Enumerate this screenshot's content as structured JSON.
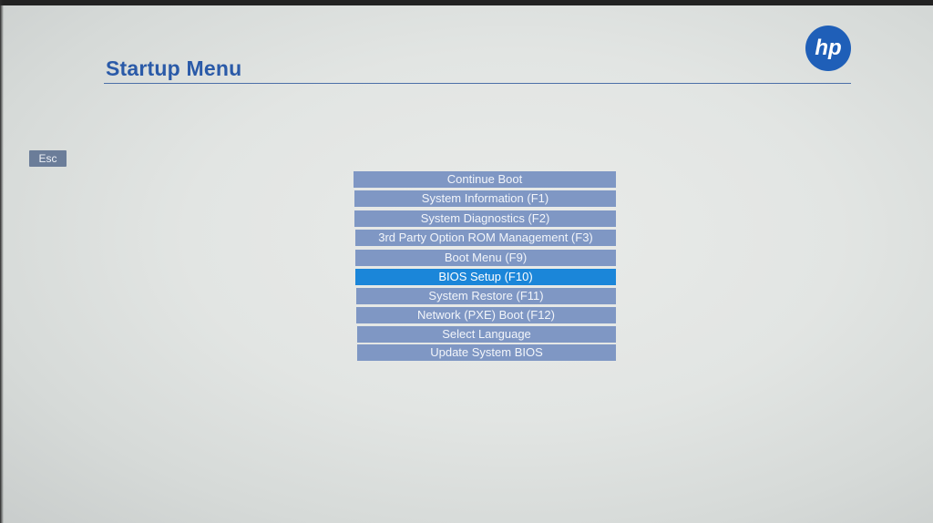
{
  "header": {
    "title": "Startup Menu",
    "logo_text": "hp"
  },
  "esc_key": {
    "label": "Esc"
  },
  "menu": {
    "selected_index": 5,
    "items": [
      {
        "label": "Continue Boot"
      },
      {
        "label": "System Information (F1)"
      },
      {
        "label": "System Diagnostics (F2)"
      },
      {
        "label": "3rd Party Option ROM Management (F3)"
      },
      {
        "label": "Boot Menu (F9)"
      },
      {
        "label": "BIOS Setup (F10)"
      },
      {
        "label": "System Restore (F11)"
      },
      {
        "label": "Network (PXE) Boot (F12)"
      },
      {
        "label": "Select Language"
      },
      {
        "label": "Update System BIOS"
      }
    ]
  },
  "colors": {
    "title": "#2a5aa8",
    "menu_item_bg": "#7f97c4",
    "menu_selected_bg": "#1b86d9",
    "logo_bg": "#1f5fb8"
  }
}
